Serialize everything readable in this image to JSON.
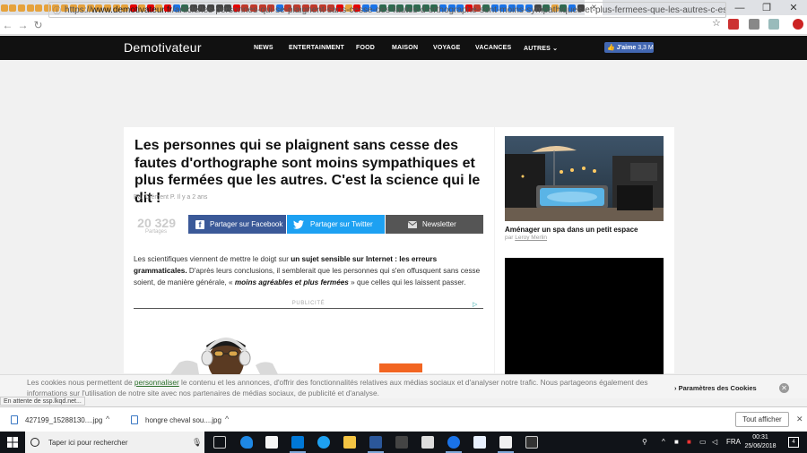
{
  "browser": {
    "address_url_prefix": "https://",
    "address_domain": "www.demotivateur.fr",
    "address_path": "/article/les-personnes-qui-se-plaignent-sans-cesse-des-fautes-d-orthographe-sont-moins-sympathiques-et-plus-fermees-que-les-autres-c-est-la-science-qui-le-dit-...",
    "active_tab_close": "×",
    "window_minimize": "—",
    "window_maximize": "❐",
    "window_close": "✕"
  },
  "site": {
    "logo": "Demotivateur",
    "nav": [
      "NEWS",
      "ENTERTAINMENT",
      "FOOD",
      "MAISON",
      "VOYAGE",
      "VACANCES",
      "AUTRES"
    ],
    "fb_like_label": "J'aime",
    "fb_like_count": "3,3 M"
  },
  "article": {
    "title": "Les personnes qui se plaignent sans cesse des fautes d'orthographe sont moins sympathiques et plus fermées que les autres. C'est la science qui le dit !",
    "byline_prefix": "Par",
    "author": "Clément P.",
    "byline_time": "Il y a 2 ans",
    "share_count": "20 329",
    "share_label": "Partages",
    "share_facebook": "Partager sur Facebook",
    "share_twitter": "Partager sur Twitter",
    "share_newsletter": "Newsletter",
    "para_1": "Les scientifiques viennent de mettre le doigt sur ",
    "para_b1": "un sujet sensible sur Internet : les erreurs grammaticales.",
    "para_2": " D'après leurs conclusions, il semblerait que les personnes qui s'en offusquent sans cesse soient, de manière générale, « ",
    "para_b2": "moins agréables et plus fermées",
    "para_3": " » que celles qui les laissent passer.",
    "pub_label": "PUBLICITÉ"
  },
  "sidebar": {
    "card_title": "Aménager un spa dans un petit espace",
    "card_by_prefix": "par",
    "card_by": "Leroy Merlin"
  },
  "cookie": {
    "text_1": "Les cookies nous permettent de ",
    "link": "personnaliser",
    "text_2": " le contenu et les annonces, d'offrir des fonctionnalités relatives aux médias sociaux et d'analyser notre trafic. Nous partageons également des informations sur l'utilisation de notre site avec nos partenaires de médias sociaux, de publicité et d'analyse.",
    "params": "Paramètres des Cookies",
    "close": "✕"
  },
  "status": "En attente de ssp.lkqd.net...",
  "downloads": {
    "items": [
      "427199_15288130....jpg",
      "hongre cheval sou....jpg"
    ],
    "show_all": "Tout afficher",
    "close": "✕"
  },
  "taskbar": {
    "search_placeholder": "Taper ici pour rechercher",
    "lang": "FRA",
    "time": "00:31",
    "date": "25/06/2018",
    "notif_count": "4"
  },
  "colors": {
    "facebook": "#3b5998",
    "twitter": "#1da1f2",
    "newsletter": "#555555",
    "header": "#111111"
  }
}
